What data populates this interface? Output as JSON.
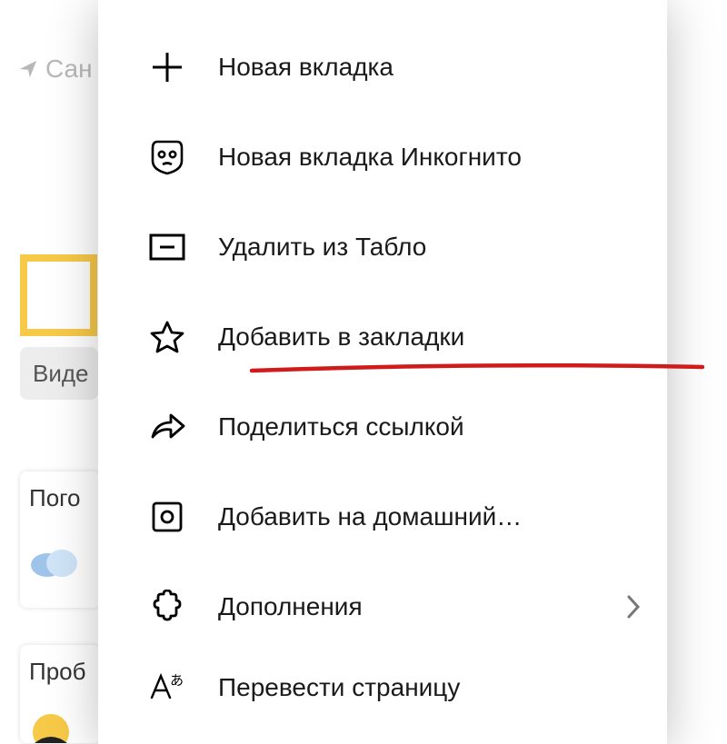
{
  "background": {
    "location_prefix": "Сан",
    "video_chip": "Виде",
    "card1_title": "Пого",
    "card2_title": "Проб"
  },
  "menu": {
    "items": [
      {
        "label": "Новая вкладка",
        "icon": "plus-icon",
        "chevron": false
      },
      {
        "label": "Новая вкладка Инкогнито",
        "icon": "incognito-icon",
        "chevron": false
      },
      {
        "label": "Удалить из Табло",
        "icon": "remove-tablo-icon",
        "chevron": false
      },
      {
        "label": "Добавить в закладки",
        "icon": "star-icon",
        "chevron": false
      },
      {
        "label": "Поделиться ссылкой",
        "icon": "share-icon",
        "chevron": false
      },
      {
        "label": "Добавить на домашний…",
        "icon": "add-home-icon",
        "chevron": false
      },
      {
        "label": "Дополнения",
        "icon": "extensions-icon",
        "chevron": true
      },
      {
        "label": "Перевести страницу",
        "icon": "translate-icon",
        "chevron": false
      }
    ]
  },
  "annotation": {
    "underline_color": "#d11a1a"
  }
}
